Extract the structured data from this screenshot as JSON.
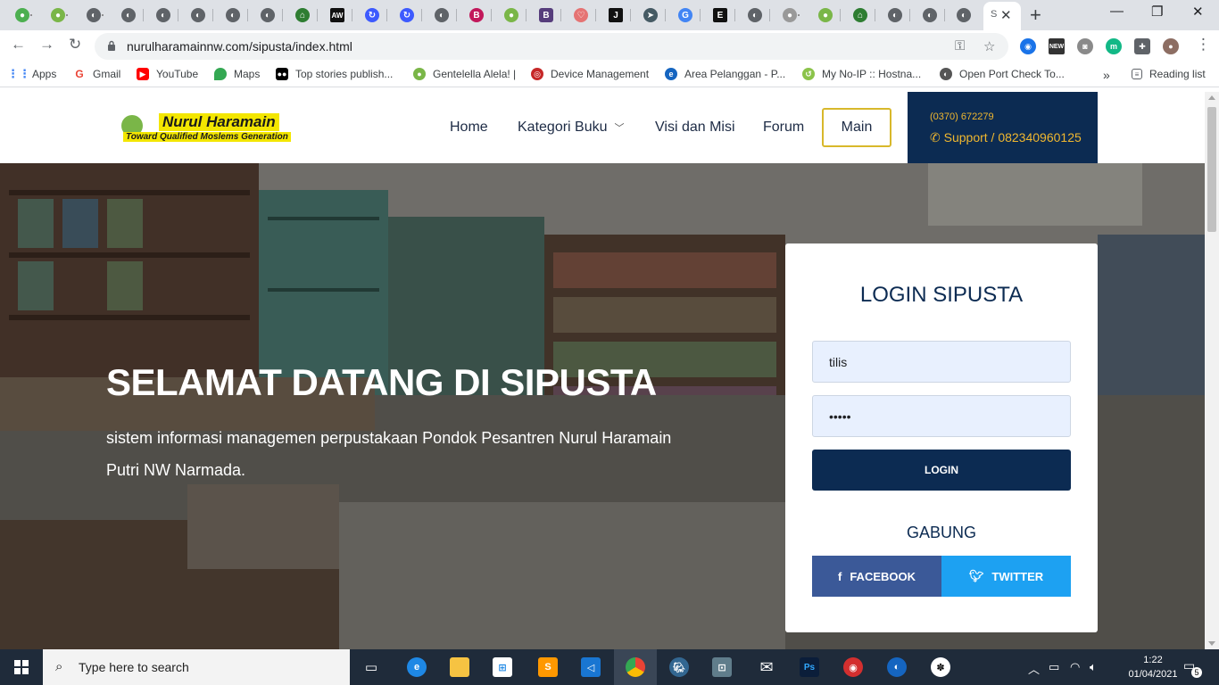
{
  "browser": {
    "active_tab_title": "S",
    "url": "nurulharamainnw.com/sipusta/index.html",
    "bookmarks": [
      {
        "label": "Apps",
        "icon": "apps-grid-icon",
        "color": "#4285f4"
      },
      {
        "label": "Gmail",
        "icon": "google-icon",
        "color": "#ea4335"
      },
      {
        "label": "YouTube",
        "icon": "youtube-icon",
        "color": "#ff0000"
      },
      {
        "label": "Maps",
        "icon": "maps-pin-icon",
        "color": "#34a853"
      },
      {
        "label": "Top stories publish...",
        "icon": "medium-icon",
        "color": "#000000"
      },
      {
        "label": "Gentelella Alela! |",
        "icon": "gentelella-icon",
        "color": "#7ab648"
      },
      {
        "label": "Device Management",
        "icon": "device-icon",
        "color": "#c62828"
      },
      {
        "label": "Area Pelanggan - P...",
        "icon": "edge-e-icon",
        "color": "#1565c0"
      },
      {
        "label": "My No-IP :: Hostna...",
        "icon": "noip-icon",
        "color": "#8bc34a"
      },
      {
        "label": "Open Port Check To...",
        "icon": "globe-icon",
        "color": "#555555"
      }
    ],
    "bookmarks_overflow": "»",
    "reading_list": "Reading list"
  },
  "site": {
    "logo_name": "Nurul Haramain",
    "logo_tagline": "Toward Qualified Moslems Generation",
    "nav": {
      "home": "Home",
      "kategori": "Kategori Buku",
      "visi": "Visi dan Misi",
      "forum": "Forum",
      "main": "Main"
    },
    "contact": {
      "phone": "(0370) 672279",
      "support": "Support / 082340960125"
    }
  },
  "hero": {
    "title": "SELAMAT DATANG DI SIPUSTA",
    "subtitle": "sistem informasi managemen perpustakaan Pondok Pesantren Nurul Haramain Putri NW Narmada."
  },
  "login": {
    "title": "LOGIN SIPUSTA",
    "username_value": "tilis",
    "password_value": "tilis",
    "button": "LOGIN",
    "join": "GABUNG",
    "facebook": "FACEBOOK",
    "twitter": "TWITTER"
  },
  "colors": {
    "navy": "#0c2b52",
    "gold": "#d8b82b",
    "facebook": "#3b5998",
    "twitter": "#1da1f2"
  },
  "taskbar": {
    "search_placeholder": "Type here to search",
    "time": "1:22",
    "date": "01/04/2021",
    "notifications": "5"
  }
}
